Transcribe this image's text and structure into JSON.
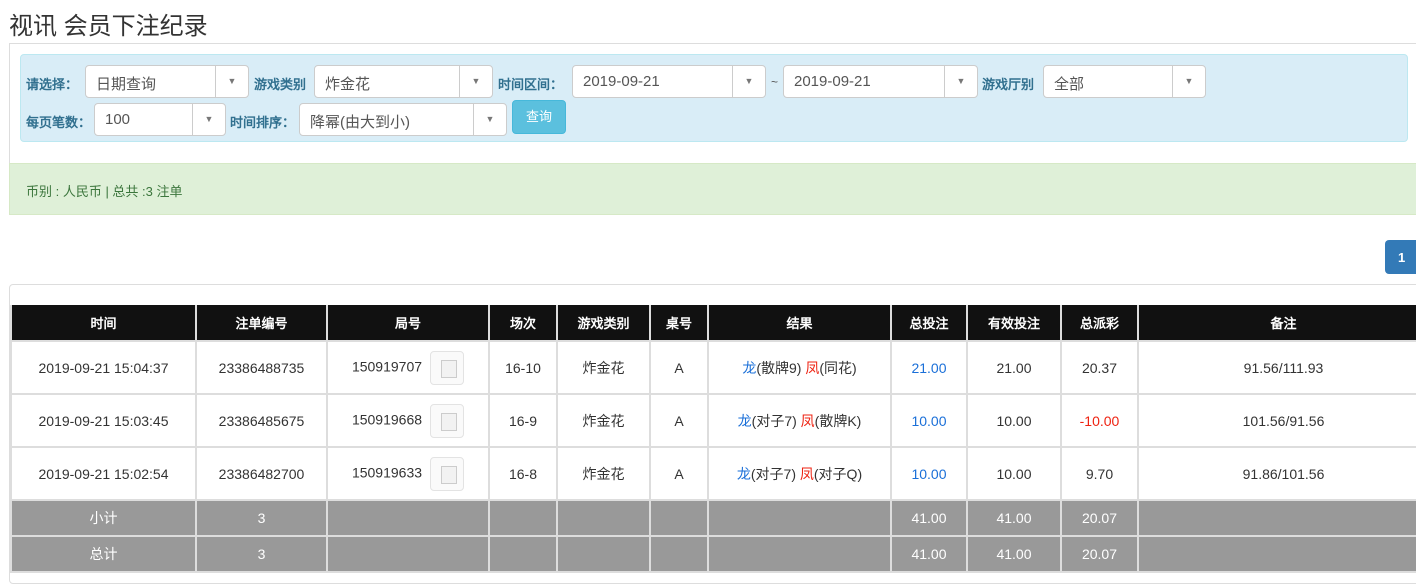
{
  "page_title": "视讯 会员下注纪录",
  "filters": {
    "select_label": "请选择：",
    "select_value": "日期查询",
    "game_type_label": "游戏类别",
    "game_type_value": "炸金花",
    "time_range_label": "时间区间：",
    "date_from": "2019-09-21",
    "tilde": "~",
    "date_to": "2019-09-21",
    "hall_label": "游戏厅别",
    "hall_value": "全部",
    "per_page_label": "每页笔数：",
    "per_page_value": "100",
    "sort_label": "时间排序：",
    "sort_value": "降幂(由大到小)",
    "search_button": "查询"
  },
  "summary": "币别 : 人民币 | 总共 :3 注单",
  "pagination": {
    "current": "1"
  },
  "table": {
    "headers": [
      "时间",
      "注单编号",
      "局号",
      "场次",
      "游戏类别",
      "桌号",
      "结果",
      "总投注",
      "有效投注",
      "总派彩",
      "备注"
    ],
    "rows": [
      {
        "time": "2019-09-21 15:04:37",
        "bet_id": "23386488735",
        "round": "150919707",
        "session": "16-10",
        "game": "炸金花",
        "table": "A",
        "dragon": "龙",
        "dragon_hand": "(散牌9)",
        "phoenix": "凤",
        "phoenix_hand": "(同花)",
        "total_bet": "21.00",
        "valid_bet": "21.00",
        "payout": "20.37",
        "payout_negative": false,
        "note": "91.56/111.93"
      },
      {
        "time": "2019-09-21 15:03:45",
        "bet_id": "23386485675",
        "round": "150919668",
        "session": "16-9",
        "game": "炸金花",
        "table": "A",
        "dragon": "龙",
        "dragon_hand": "(对子7)",
        "phoenix": "凤",
        "phoenix_hand": "(散牌K)",
        "total_bet": "10.00",
        "valid_bet": "10.00",
        "payout": "-10.00",
        "payout_negative": true,
        "note": "101.56/91.56"
      },
      {
        "time": "2019-09-21 15:02:54",
        "bet_id": "23386482700",
        "round": "150919633",
        "session": "16-8",
        "game": "炸金花",
        "table": "A",
        "dragon": "龙",
        "dragon_hand": "(对子7)",
        "phoenix": "凤",
        "phoenix_hand": "(对子Q)",
        "total_bet": "10.00",
        "valid_bet": "10.00",
        "payout": "9.70",
        "payout_negative": false,
        "note": "91.86/101.56"
      }
    ],
    "subtotal": {
      "label": "小计",
      "count": "3",
      "total_bet": "41.00",
      "valid_bet": "41.00",
      "payout": "20.07"
    },
    "total": {
      "label": "总计",
      "count": "3",
      "total_bet": "41.00",
      "valid_bet": "41.00",
      "payout": "20.07"
    }
  },
  "colors": {
    "header_bg": "#111111",
    "blue": "#1a6fd8",
    "red": "#ee2211",
    "summary_bg": "#999999"
  }
}
